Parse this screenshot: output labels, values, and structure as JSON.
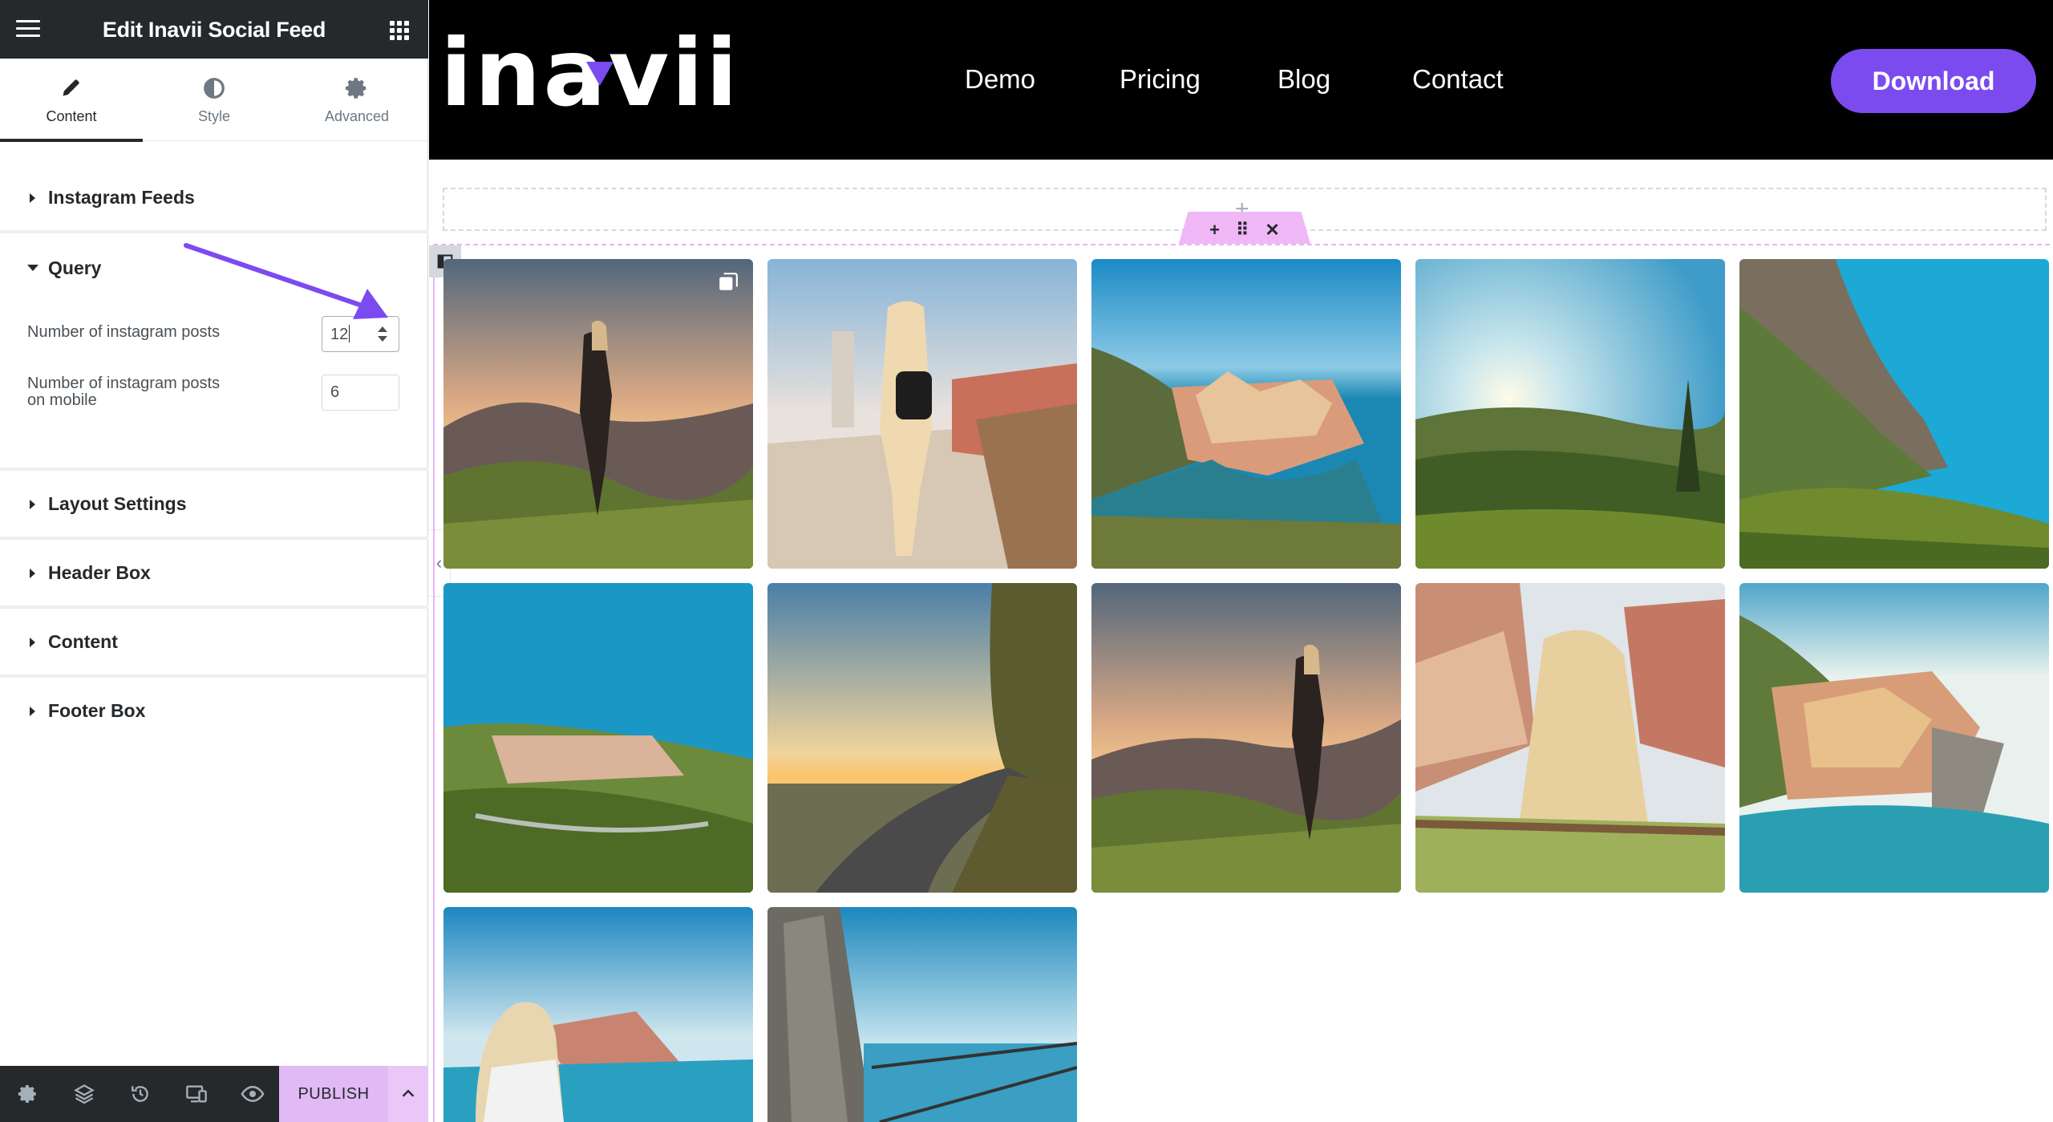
{
  "editor": {
    "title": "Edit Inavii Social Feed",
    "tabs": [
      {
        "label": "Content",
        "icon": "pencil-icon"
      },
      {
        "label": "Style",
        "icon": "half-circle-icon"
      },
      {
        "label": "Advanced",
        "icon": "gear-icon"
      }
    ],
    "sections": {
      "instagram_feeds": "Instagram Feeds",
      "query": "Query",
      "layout_settings": "Layout Settings",
      "header_box": "Header Box",
      "content": "Content",
      "footer_box": "Footer Box"
    },
    "query": {
      "posts_label": "Number of instagram posts",
      "posts_value": "12",
      "mobile_label_line1": "Number of instagram posts",
      "mobile_label_line2": "on mobile",
      "mobile_value": "6"
    },
    "footer": {
      "publish_label": "PUBLISH",
      "icons": [
        "settings-icon",
        "layers-icon",
        "history-icon",
        "responsive-icon",
        "eye-icon"
      ]
    },
    "arrow_color": "#7b4bf0"
  },
  "site": {
    "logo": "inavii",
    "nav": [
      "Demo",
      "Pricing",
      "Blog",
      "Contact"
    ],
    "download_label": "Download",
    "accent": "#7b4bf0"
  },
  "feed": {
    "photos": [
      {
        "alt": "woman-on-cliff-sunset"
      },
      {
        "alt": "woman-walking-village-path"
      },
      {
        "alt": "coastal-village-harbor"
      },
      {
        "alt": "sunset-over-green-hills"
      },
      {
        "alt": "coastline-cliffs"
      },
      {
        "alt": "hillside-village-sea"
      },
      {
        "alt": "coastal-road-sunset"
      },
      {
        "alt": "woman-on-cliff-sunset-2"
      },
      {
        "alt": "woman-looking-at-village"
      },
      {
        "alt": "colorful-village-on-rock"
      },
      {
        "alt": "woman-overlooking-village"
      },
      {
        "alt": "cliff-walkway-railing"
      }
    ]
  }
}
